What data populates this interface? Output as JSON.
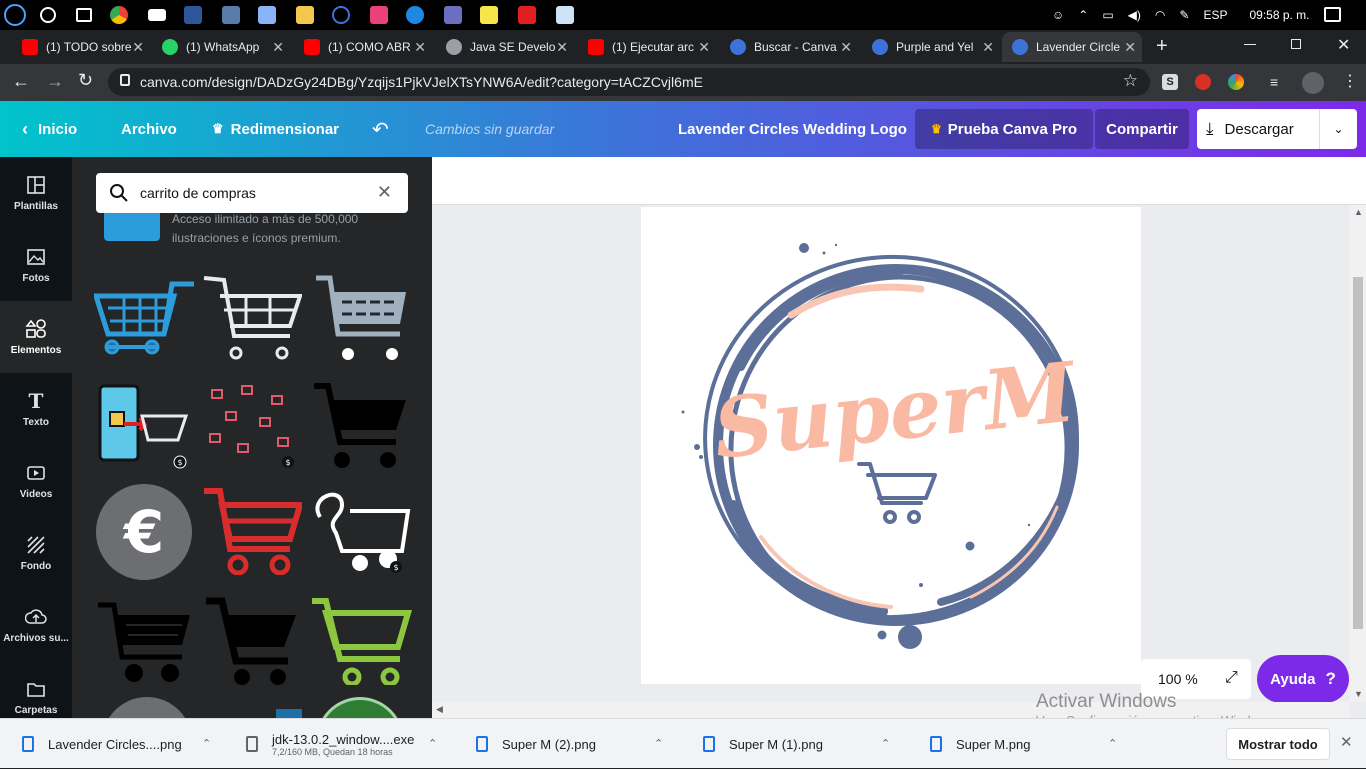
{
  "taskbar": {
    "language": "ESP",
    "time": "09:58 p. m."
  },
  "tabs": [
    {
      "title": "(1) TODO sobre",
      "favicon": "youtube-icon",
      "color": "#ff0000"
    },
    {
      "title": "(1) WhatsApp",
      "favicon": "whatsapp-icon",
      "color": "#25d366"
    },
    {
      "title": "(1) COMO ABR",
      "favicon": "youtube-icon",
      "color": "#ff0000"
    },
    {
      "title": "Java SE Develo",
      "favicon": "globe-icon",
      "color": "#9aa0a6"
    },
    {
      "title": "(1) Ejecutar arc",
      "favicon": "youtube-icon",
      "color": "#ff0000"
    },
    {
      "title": "Buscar - Canva",
      "favicon": "canva-icon",
      "color": "#3d73d9"
    },
    {
      "title": "Purple and Yel",
      "favicon": "canva-icon",
      "color": "#3d73d9"
    },
    {
      "title": "Lavender Circle",
      "favicon": "canva-icon",
      "color": "#3d73d9"
    }
  ],
  "address_bar": {
    "url": "canva.com/design/DADzGy24DBg/Yzqijs1PjkVJelXTsYNW6A/edit?category=tACZCvjl6mE"
  },
  "canva_header": {
    "home_label": "Inicio",
    "file_label": "Archivo",
    "resize_label": "Redimensionar",
    "status": "Cambios sin guardar",
    "design_title": "Lavender Circles Wedding Logo",
    "pro_label": "Prueba Canva Pro",
    "share_label": "Compartir",
    "download_label": "Descargar"
  },
  "rail": [
    {
      "label": "Plantillas",
      "icon": "templates-icon"
    },
    {
      "label": "Fotos",
      "icon": "photos-icon"
    },
    {
      "label": "Elementos",
      "icon": "elements-icon"
    },
    {
      "label": "Texto",
      "icon": "text-icon"
    },
    {
      "label": "Videos",
      "icon": "video-icon"
    },
    {
      "label": "Fondo",
      "icon": "background-icon"
    },
    {
      "label": "Archivos su...",
      "icon": "upload-icon"
    },
    {
      "label": "Carpetas",
      "icon": "folder-icon"
    }
  ],
  "panel": {
    "search_value": "carrito de compras",
    "promo_text_1": "Acceso ilimitado a más de 500,000",
    "promo_text_2": "ilustraciones e íconos premium."
  },
  "design": {
    "logo_text": "SuperM",
    "ring_color": "#5b6f99",
    "pink_color": "#f9c6b4",
    "cart_color": "#5b6f99"
  },
  "canvas": {
    "zoom": "100 %",
    "help_label": "Ayuda",
    "help_glyph": "?"
  },
  "watermark": {
    "title": "Activar Windows",
    "subtitle": "Ve a Configuración para activar Windows."
  },
  "downloads": [
    {
      "name": "Lavender Circles....png",
      "sub": ""
    },
    {
      "name": "jdk-13.0.2_window....exe",
      "sub": "7,2/160 MB, Quedan 18 horas"
    },
    {
      "name": "Super M (2).png",
      "sub": ""
    },
    {
      "name": "Super M (1).png",
      "sub": ""
    },
    {
      "name": "Super M.png",
      "sub": ""
    }
  ],
  "show_all_label": "Mostrar todo"
}
